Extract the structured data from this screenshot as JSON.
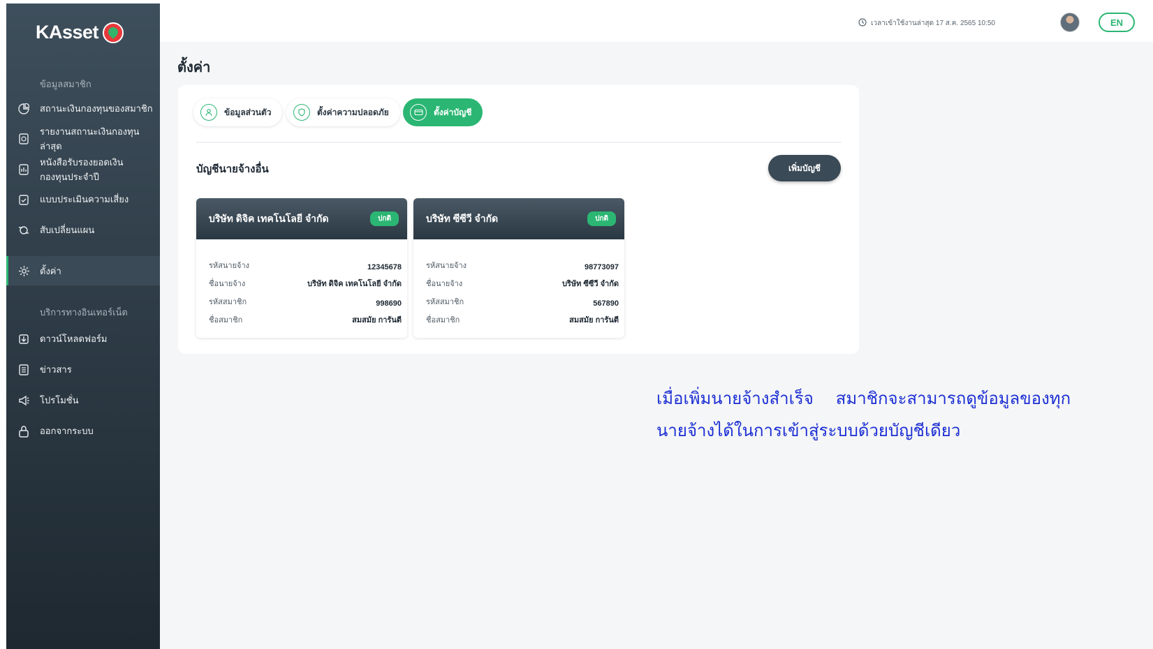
{
  "brand": {
    "name": "KAsset"
  },
  "header": {
    "last_login": "เวลาเข้าใช้งานล่าสุด 17 ส.ค. 2565 10:50",
    "language": "EN"
  },
  "sidebar": {
    "section_member": "ข้อมูลสมาชิก",
    "section_online": "บริการทางอินเทอร์เน็ต",
    "items": [
      {
        "label": "สถานะเงินกองทุนของสมาชิก",
        "icon": "pie-chart-icon"
      },
      {
        "label": "รายงานสถานะเงินกองทุนล่าสุด",
        "icon": "report-icon"
      },
      {
        "label": "หนังสือรับรองยอดเงินกองทุนประจำปี",
        "icon": "certificate-icon"
      },
      {
        "label": "แบบประเมินความเสี่ยง",
        "icon": "clipboard-icon"
      },
      {
        "label": "สับเปลี่ยนแผน",
        "icon": "switch-plan-icon"
      },
      {
        "label": "ตั้งค่า",
        "icon": "gear-icon"
      },
      {
        "label": "ดาวน์โหลดฟอร์ม",
        "icon": "download-icon"
      },
      {
        "label": "ข่าวสาร",
        "icon": "news-icon"
      },
      {
        "label": "โปรโมชั่น",
        "icon": "megaphone-icon"
      },
      {
        "label": "ออกจากระบบ",
        "icon": "lock-icon"
      }
    ]
  },
  "main": {
    "title": "ตั้งค่า",
    "tabs": [
      {
        "label": "ข้อมูลส่วนตัว",
        "icon": "user-icon"
      },
      {
        "label": "ตั้งค่าความปลอดภัย",
        "icon": "shield-icon"
      },
      {
        "label": "ตั้งค่าบัญชี",
        "icon": "card-icon"
      }
    ],
    "section_heading": "บัญชีนายจ้างอื่น",
    "add_button": "เพิ่มบัญชี",
    "cards": [
      {
        "company": "บริษัท ดิจิค เทคโนโลยี จำกัด",
        "status": "ปกติ",
        "rows": [
          {
            "k": "รหัสนายจ้าง",
            "v": "12345678"
          },
          {
            "k": "ชื่อนายจ้าง",
            "v": "บริษัท ดิจิค เทคโนโลยี จำกัด"
          },
          {
            "k": "รหัสสมาชิก",
            "v": "998690"
          },
          {
            "k": "ชื่อสมาชิก",
            "v": "สมสมัย การันตี"
          }
        ]
      },
      {
        "company": "บริษัท ซีซีวี จำกัด",
        "status": "ปกติ",
        "rows": [
          {
            "k": "รหัสนายจ้าง",
            "v": "98773097"
          },
          {
            "k": "ชื่อนายจ้าง",
            "v": "บริษัท ซีซีวี จำกัด"
          },
          {
            "k": "รหัสสมาชิก",
            "v": "567890"
          },
          {
            "k": "ชื่อสมาชิก",
            "v": "สมสมัย การันตี"
          }
        ]
      }
    ]
  },
  "note": {
    "line1a": "เมื่อเพิ่มนายจ้างสำเร็จ",
    "line1b": "สมาชิกจะสามารถดูข้อมูลของทุก",
    "line2": "นายจ้างได้ในการเข้าสู่ระบบด้วยบัญชีเดียว"
  },
  "colors": {
    "accent": "#2bb673",
    "sidebar": "#2f3d48",
    "note": "#1c2fd4"
  }
}
